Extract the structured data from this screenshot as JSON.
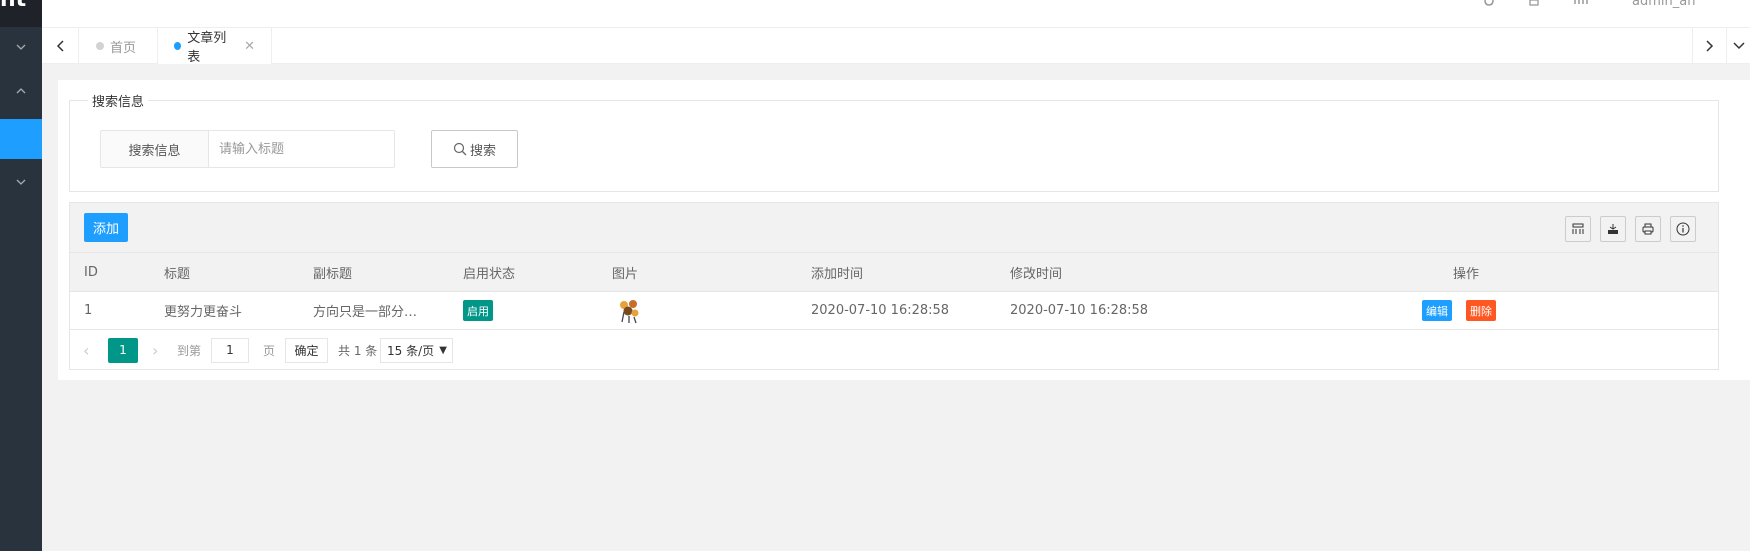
{
  "sidebar": {
    "logo_text": "nt"
  },
  "header": {
    "user_name": "admin_an"
  },
  "tabs": [
    {
      "label": "首页",
      "active": false
    },
    {
      "label": "文章列表",
      "active": true
    }
  ],
  "search": {
    "legend": "搜索信息",
    "label": "搜索信息",
    "placeholder": "请输入标题",
    "button_label": "搜索"
  },
  "toolbar": {
    "add_label": "添加"
  },
  "table": {
    "columns": [
      "ID",
      "标题",
      "副标题",
      "启用状态",
      "图片",
      "添加时间",
      "修改时间",
      "操作"
    ],
    "rows": [
      {
        "id": "1",
        "title": "更努力更奋斗",
        "subtitle": "方向只是一部分…",
        "status": "启用",
        "added": "2020-07-10 16:28:58",
        "modified": "2020-07-10 16:28:58",
        "edit_label": "编辑",
        "delete_label": "删除"
      }
    ]
  },
  "pager": {
    "current": "1",
    "goto_label": "到第",
    "goto_value": "1",
    "page_label": "页",
    "ok_label": "确定",
    "total_text": "共 1 条",
    "limit_text": "15 条/页"
  },
  "colors": {
    "accent": "#1e9fff",
    "green": "#009688",
    "danger": "#ff5722",
    "sidebar": "#28333e"
  }
}
